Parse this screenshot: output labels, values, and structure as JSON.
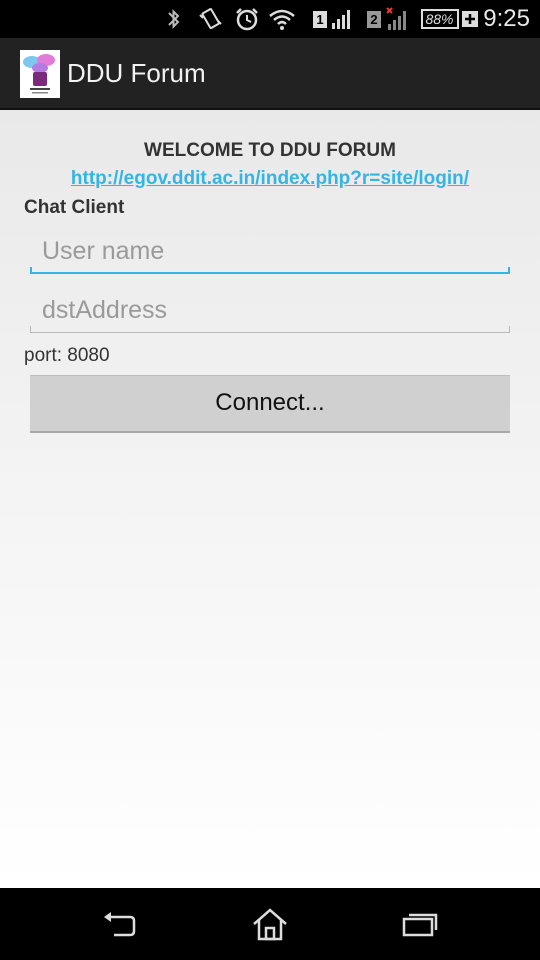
{
  "status_bar": {
    "time": "9:25",
    "battery_percent": "88%",
    "sim1_label": "1",
    "sim2_label": "2",
    "icons": [
      "bluetooth-icon",
      "vibrate-icon",
      "alarm-icon",
      "wifi-icon",
      "signal-sim1-icon",
      "signal-sim2-icon",
      "battery-icon"
    ]
  },
  "action_bar": {
    "title": "DDU Forum",
    "logo_icon": "ddu-forum-logo"
  },
  "main": {
    "welcome_text": "WELCOME TO DDU FORUM",
    "link_text": "http://egov.ddit.ac.in/index.php?r=site/login/",
    "section_label": "Chat Client",
    "username_field": {
      "value": "",
      "placeholder": "User name"
    },
    "dst_address_field": {
      "value": "",
      "placeholder": "dstAddress"
    },
    "port_text": "port: 8080",
    "connect_label": "Connect..."
  },
  "nav_bar": {
    "icons": [
      "back-icon",
      "home-icon",
      "recent-apps-icon"
    ]
  },
  "colors": {
    "accent": "#33b5e5",
    "action_bar_bg": "#222222",
    "button_bg": "#d0d0d0"
  }
}
